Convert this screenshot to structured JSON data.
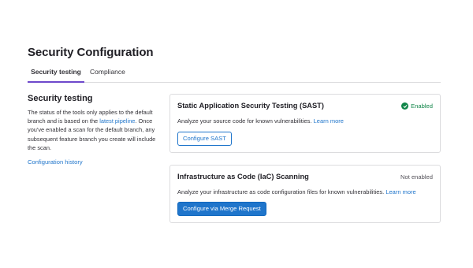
{
  "page": {
    "title": "Security Configuration"
  },
  "tabs": [
    {
      "label": "Security testing",
      "active": true
    },
    {
      "label": "Compliance",
      "active": false
    }
  ],
  "sidebar": {
    "heading": "Security testing",
    "text_before_link": "The status of the tools only applies to the default branch and is based on the ",
    "link_text": "latest pipeline",
    "text_after_link": ". Once you've enabled a scan for the default branch, any subsequent feature branch you create will include the scan.",
    "history_link": "Configuration history"
  },
  "cards": [
    {
      "title": "Static Application Security Testing (SAST)",
      "status": "Enabled",
      "status_icon": "check-circle-icon",
      "description": "Analyze your source code for known vulnerabilities.",
      "learn_more": "Learn more",
      "button_label": "Configure SAST"
    },
    {
      "title": "Infrastructure as Code (IaC) Scanning",
      "status": "Not enabled",
      "description": "Analyze your infrastructure as code configuration files for known vulnerabilities.",
      "learn_more": "Learn more",
      "button_label": "Configure via Merge Request"
    }
  ],
  "colors": {
    "accent": "#1f75cb",
    "tab_active": "#6e49cb",
    "success": "#108548"
  }
}
